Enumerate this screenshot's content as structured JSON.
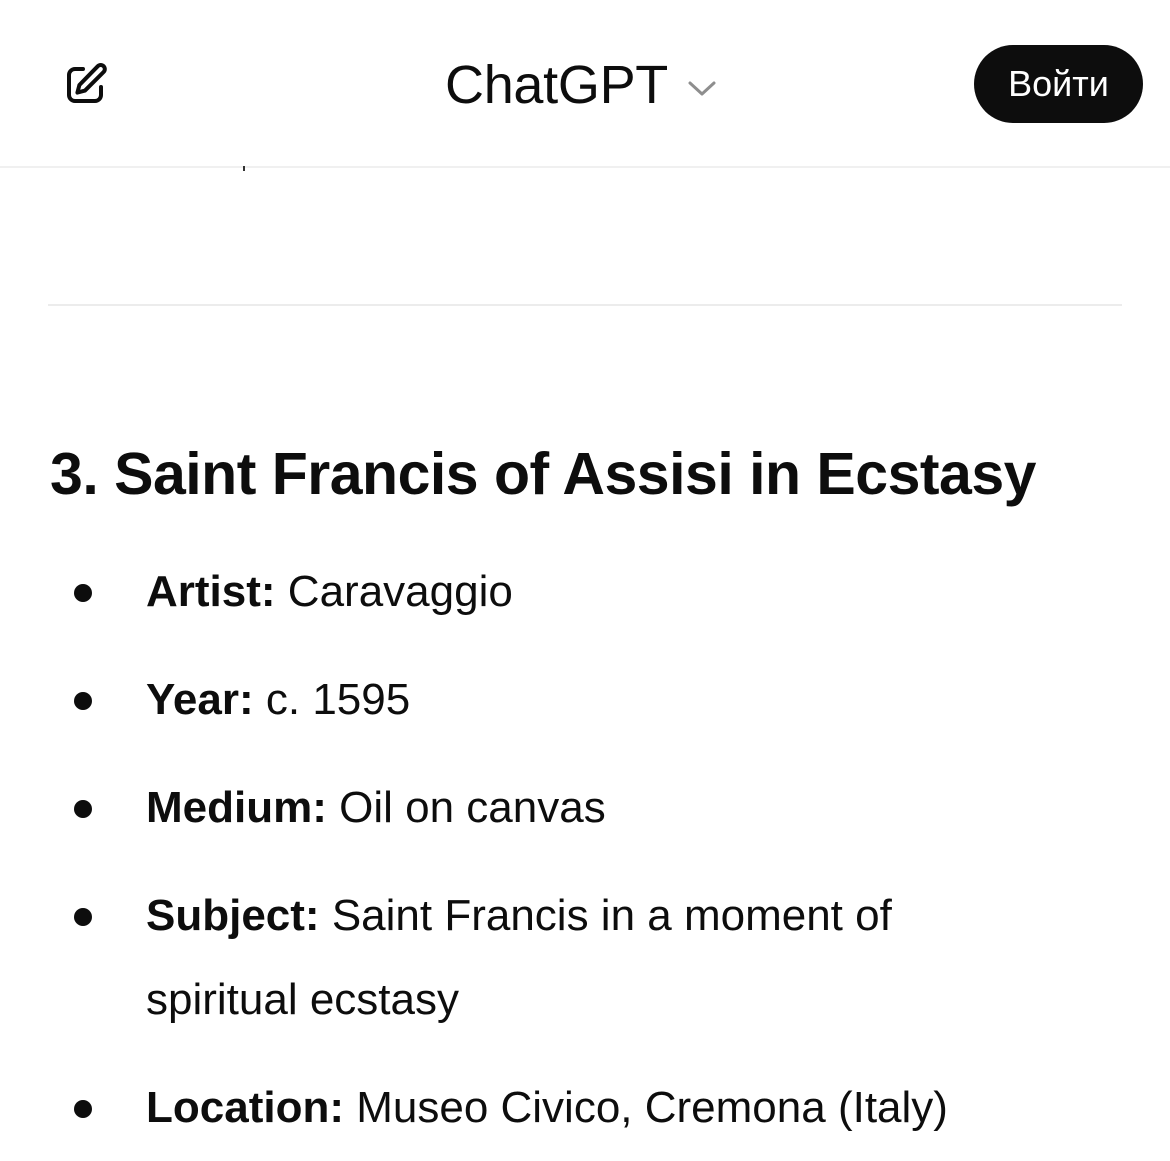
{
  "header": {
    "title": "ChatGPT",
    "login_label": "Войти",
    "new_chat_icon": "edit-icon",
    "title_dropdown_icon": "chevron-down-icon"
  },
  "content": {
    "heading": "3. Saint Francis of Assisi in Ecstasy",
    "items": [
      {
        "label": "Artist:",
        "value": "Caravaggio"
      },
      {
        "label": "Year:",
        "value": "c. 1595"
      },
      {
        "label": "Medium:",
        "value": "Oil on canvas"
      },
      {
        "label": "Subject:",
        "value": "Saint Francis in a moment of spiritual ecstasy"
      },
      {
        "label": "Location:",
        "value": "Museo Civico, Cremona (Italy)"
      }
    ]
  },
  "colors": {
    "text": "#0d0d0d",
    "button_bg": "#0d0d0d",
    "button_text": "#ffffff",
    "divider": "#ececec"
  }
}
